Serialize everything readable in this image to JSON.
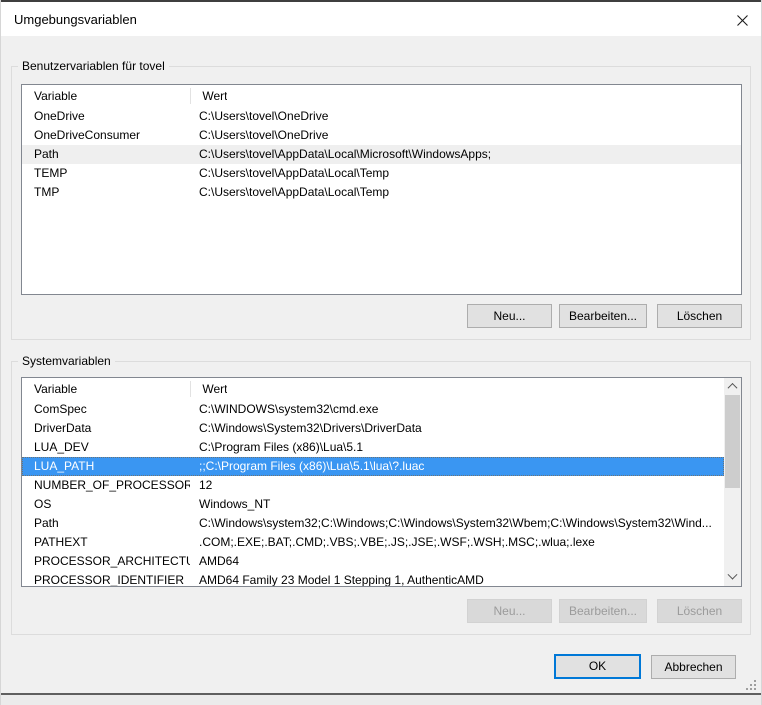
{
  "window": {
    "title": "Umgebungsvariablen",
    "close_icon": "x"
  },
  "columns": {
    "variable": "Variable",
    "value": "Wert"
  },
  "user_section": {
    "label": "Benutzervariablen für tovel",
    "rows": [
      {
        "name": "OneDrive",
        "value": "C:\\Users\\tovel\\OneDrive",
        "state": "normal"
      },
      {
        "name": "OneDriveConsumer",
        "value": "C:\\Users\\tovel\\OneDrive",
        "state": "normal"
      },
      {
        "name": "Path",
        "value": "C:\\Users\\tovel\\AppData\\Local\\Microsoft\\WindowsApps;",
        "state": "hover"
      },
      {
        "name": "TEMP",
        "value": "C:\\Users\\tovel\\AppData\\Local\\Temp",
        "state": "normal"
      },
      {
        "name": "TMP",
        "value": "C:\\Users\\tovel\\AppData\\Local\\Temp",
        "state": "normal"
      }
    ],
    "buttons": {
      "new": "Neu...",
      "edit": "Bearbeiten...",
      "delete": "Löschen"
    }
  },
  "system_section": {
    "label": "Systemvariablen",
    "rows": [
      {
        "name": "ComSpec",
        "value": "C:\\WINDOWS\\system32\\cmd.exe",
        "state": "normal"
      },
      {
        "name": "DriverData",
        "value": "C:\\Windows\\System32\\Drivers\\DriverData",
        "state": "normal"
      },
      {
        "name": "LUA_DEV",
        "value": "C:\\Program Files (x86)\\Lua\\5.1",
        "state": "normal"
      },
      {
        "name": "LUA_PATH",
        "value": ";;C:\\Program Files (x86)\\Lua\\5.1\\lua\\?.luac",
        "state": "selected"
      },
      {
        "name": "NUMBER_OF_PROCESSORS",
        "value": "12",
        "state": "normal"
      },
      {
        "name": "OS",
        "value": "Windows_NT",
        "state": "normal"
      },
      {
        "name": "Path",
        "value": "C:\\Windows\\system32;C:\\Windows;C:\\Windows\\System32\\Wbem;C:\\Windows\\System32\\Wind...",
        "state": "normal"
      },
      {
        "name": "PATHEXT",
        "value": ".COM;.EXE;.BAT;.CMD;.VBS;.VBE;.JS;.JSE;.WSF;.WSH;.MSC;.wlua;.lexe",
        "state": "normal"
      },
      {
        "name": "PROCESSOR_ARCHITECTURE",
        "value": "AMD64",
        "state": "normal"
      },
      {
        "name": "PROCESSOR_IDENTIFIER",
        "value": "AMD64 Family 23 Model 1 Stepping 1, AuthenticAMD",
        "state": "normal"
      }
    ],
    "buttons": {
      "new": "Neu...",
      "edit": "Bearbeiten...",
      "delete": "Löschen"
    }
  },
  "footer": {
    "ok": "OK",
    "cancel": "Abbrechen"
  },
  "colors": {
    "selection_blue": "#3a96f2",
    "default_button_border": "#0078d7",
    "dialog_background": "#f0f0f0",
    "list_border": "#828790"
  }
}
